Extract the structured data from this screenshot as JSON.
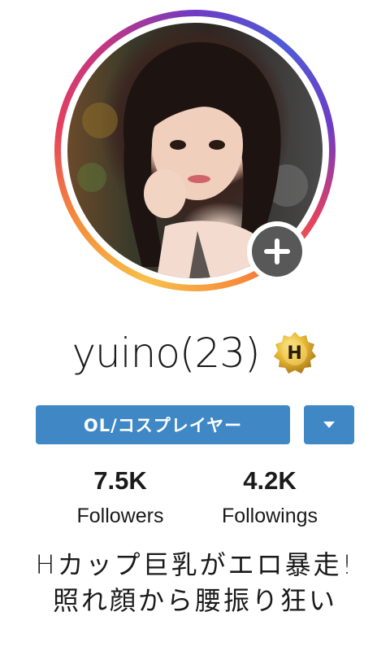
{
  "profile": {
    "username": "yuino(23)",
    "verified_badge_letter": "H",
    "role_label": "OL/コスプレイヤー",
    "bio_line_1": "Hカップ巨乳がエロ暴走!",
    "bio_line_2": "照れ顔から腰振り狂い"
  },
  "stats": {
    "followers_value": "7.5K",
    "followers_label": "Followers",
    "followings_value": "4.2K",
    "followings_label": "Followings"
  },
  "icons": {
    "add": "plus-circle-icon",
    "dropdown": "caret-down-icon",
    "verified": "gold-seal-badge-icon"
  },
  "colors": {
    "accent_button": "#3f88c5",
    "add_badge": "#585858",
    "ring_gradient": [
      "#f7c04a",
      "#e4405f",
      "#c13584",
      "#4f5bd5"
    ],
    "badge_gold": "#d8a827"
  }
}
